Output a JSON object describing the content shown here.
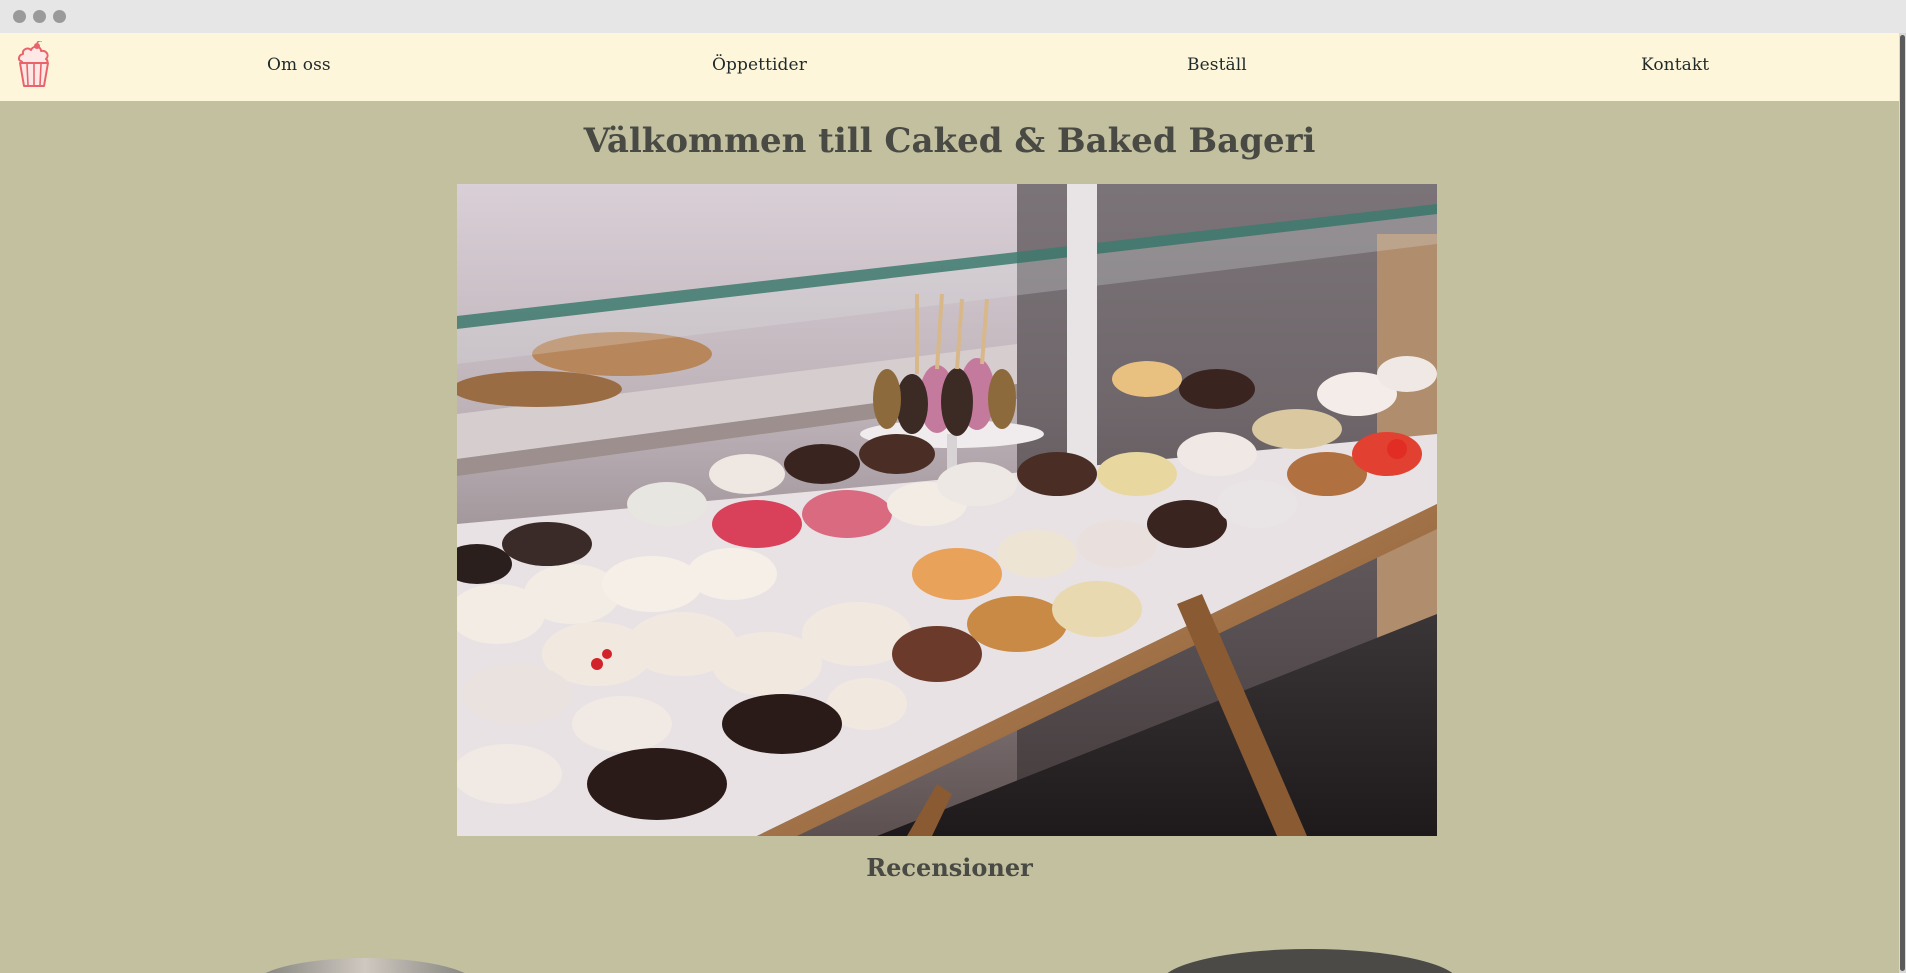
{
  "navbar": {
    "logo_icon": "cupcake-icon",
    "links": [
      {
        "label": "Om oss"
      },
      {
        "label": "Öppettider"
      },
      {
        "label": "Beställ"
      },
      {
        "label": "Kontakt"
      }
    ]
  },
  "main": {
    "title": "Välkommen till Caked & Baked Bageri",
    "reviews_title": "Recensioner"
  },
  "colors": {
    "page_background": "#c2c09f",
    "navbar_background": "#fef6da",
    "heading_text": "#4a4a45",
    "logo_pink": "#e8646a"
  }
}
